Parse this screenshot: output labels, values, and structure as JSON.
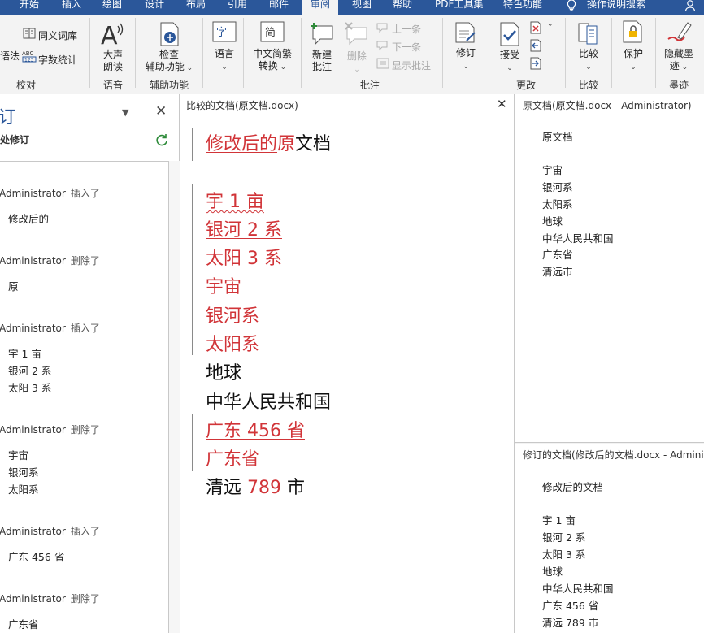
{
  "tabs": [
    "开始",
    "插入",
    "绘图",
    "设计",
    "布局",
    "引用",
    "邮件",
    "审阅",
    "视图",
    "帮助",
    "PDF工具集",
    "特色功能",
    "操作说明搜索"
  ],
  "ribbon": {
    "proofing": {
      "thesaurus": "同义词库",
      "grammar": "语法",
      "word_count": "字数统计",
      "label": "校对"
    },
    "speech": {
      "read_aloud_1": "大声",
      "read_aloud_2": "朗读",
      "label": "语音"
    },
    "accessibility": {
      "check_1": "检查",
      "check_2": "辅助功能",
      "label": "辅助功能"
    },
    "language": {
      "btn": "语言"
    },
    "chinese": {
      "btn_1": "中文简繁",
      "btn_2": "转换"
    },
    "comments": {
      "new_1": "新建",
      "new_2": "批注",
      "delete": "删除",
      "prev": "上一条",
      "next": "下一条",
      "show": "显示批注",
      "label": "批注"
    },
    "tracking": {
      "btn": "修订"
    },
    "changes": {
      "accept": "接受",
      "label": "更改"
    },
    "compare": {
      "btn": "比较",
      "label": "比较"
    },
    "protect": {
      "btn": "保护"
    },
    "ink": {
      "btn_1": "隐藏墨",
      "btn_2": "迹",
      "label": "墨迹"
    }
  },
  "revisions_pane": {
    "title": "订",
    "subtitle": "处修订",
    "items": [
      {
        "author": "Administrator",
        "action": "插入了",
        "lines": [
          "修改后的"
        ]
      },
      {
        "author": "Administrator",
        "action": "删除了",
        "lines": [
          "原"
        ]
      },
      {
        "author": "Administrator",
        "action": "插入了",
        "lines": [
          "宇 1 亩",
          "银河 2 系",
          "太阳 3 系"
        ]
      },
      {
        "author": "Administrator",
        "action": "删除了",
        "lines": [
          "宇宙",
          "银河系",
          "太阳系"
        ]
      },
      {
        "author": "Administrator",
        "action": "插入了",
        "lines": [
          "广东 456 省"
        ]
      },
      {
        "author": "Administrator",
        "action": "删除了",
        "lines": [
          "广东省"
        ]
      }
    ]
  },
  "compared_doc": {
    "title": "比较的文档(原文档.docx)",
    "line1_ins": "修改后的",
    "line1_del": "原",
    "line1_rest": "文档",
    "ins1": "宇 1 亩",
    "ins2": "银河 2 系",
    "ins3": "太阳 3 系",
    "del1": "宇宙",
    "del2": "银河系",
    "del3": "太阳系",
    "earth": "地球",
    "prc": "中华人民共和国",
    "ins_gd": "广东 456 省",
    "del_gd": "广东省",
    "qy_pre": "清远 ",
    "qy_ins": "789 ",
    "qy_post": "市"
  },
  "original_doc": {
    "title": "原文档(原文档.docx - Administrator)",
    "lines": [
      "原文档",
      "宇宙",
      "银河系",
      "太阳系",
      "地球",
      "中华人民共和国",
      "广东省",
      "清远市"
    ]
  },
  "revised_doc": {
    "title": "修订的文档(修改后的文档.docx - Administrator)",
    "lines": [
      "修改后的文档",
      "宇 1 亩",
      "银河 2 系",
      "太阳 3 系",
      "地球",
      "中华人民共和国",
      "广东 456 省",
      "清远 789 市"
    ]
  },
  "colors": {
    "tabbar": "#2b579a",
    "insert": "#d13438",
    "accent": "#2b579a"
  }
}
